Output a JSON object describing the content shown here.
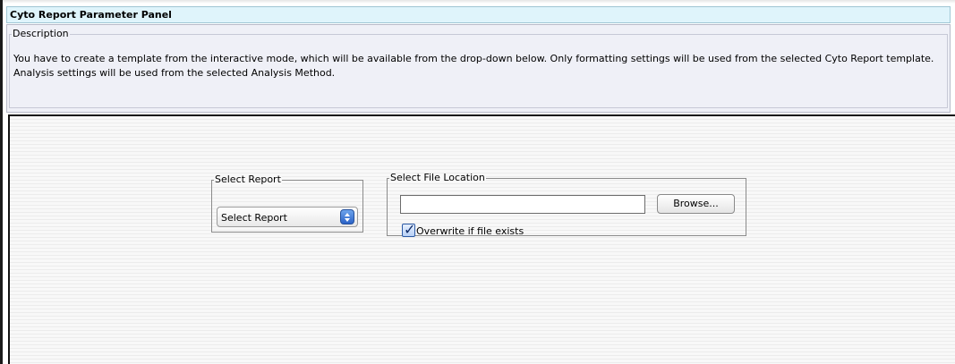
{
  "panel": {
    "title": "Cyto Report Parameter Panel"
  },
  "description": {
    "legend": "Description",
    "text": "You have to create a template from the interactive mode, which will be available from the drop-down below. Only formatting settings will be used from the selected Cyto Report template. Analysis settings will be used from the selected Analysis Method."
  },
  "report": {
    "legend": "Select Report",
    "selected": "Select Report",
    "arrow_icon": "updown-arrow-icon",
    "accent_color": "#2c63c7"
  },
  "file_location": {
    "legend": "Select File Location",
    "value": "",
    "browse_label": "Browse...",
    "overwrite_label": "Overwrite if file exists",
    "overwrite_checked": true
  }
}
